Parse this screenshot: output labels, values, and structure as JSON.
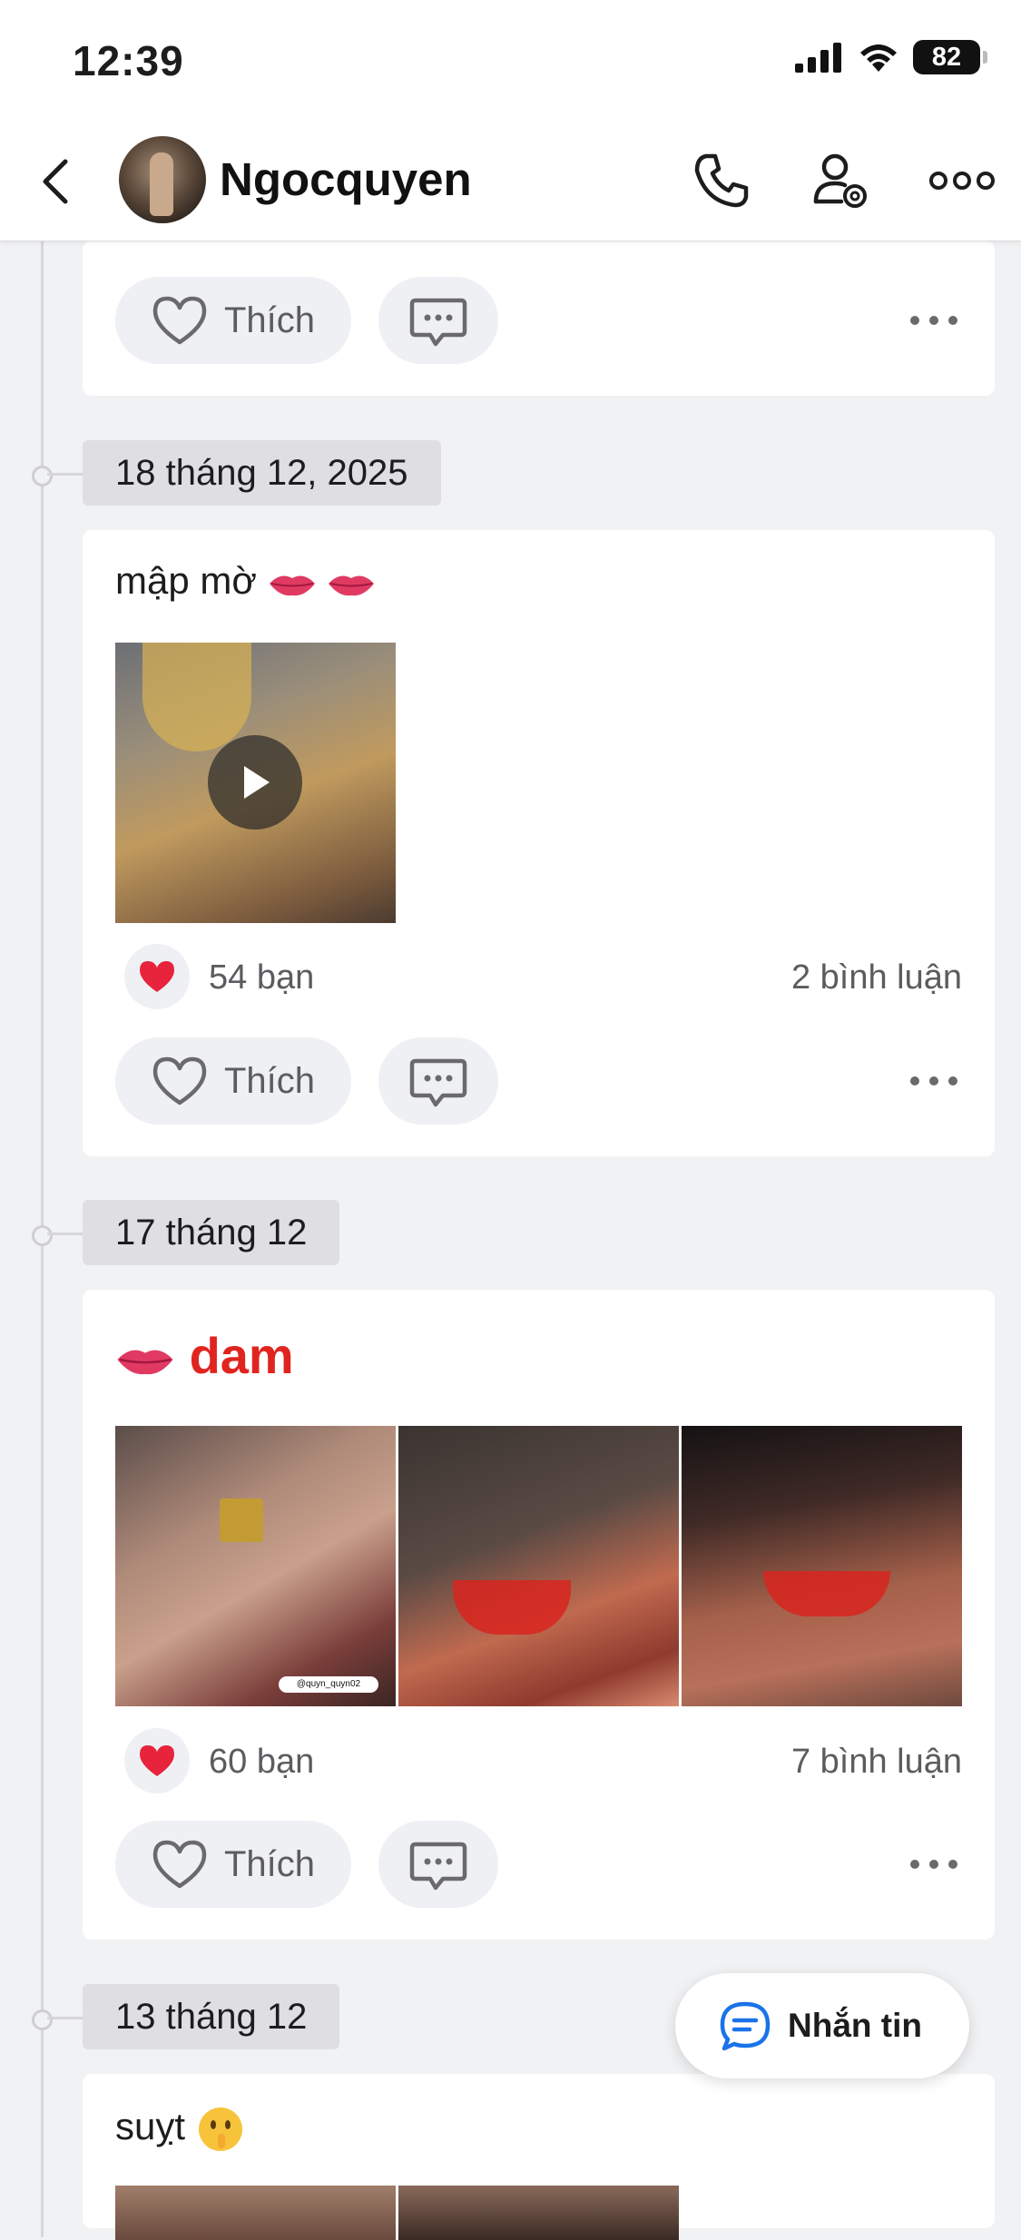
{
  "status_bar": {
    "time": "12:39",
    "battery": "82"
  },
  "header": {
    "name": "Ngocquyen"
  },
  "top_card": {
    "like_label": "Thích"
  },
  "posts": [
    {
      "date": "18 tháng 12, 2025",
      "text": "mập mờ",
      "reaction_count": "54 bạn",
      "comment_count": "2 bình luận",
      "like_label": "Thích"
    },
    {
      "date": "17 tháng 12",
      "text": "dam",
      "reaction_count": "60 bạn",
      "comment_count": "7 bình luận",
      "like_label": "Thích",
      "image_caption": "@quyn_quyn02"
    },
    {
      "date": "13 tháng 12",
      "text": "suỵt"
    }
  ],
  "fab": {
    "label": "Nhắn tin"
  },
  "colors": {
    "accent": "#1a73e8",
    "heart": "#e8243c",
    "title_red": "#e0241f"
  },
  "icons": [
    "back-icon",
    "phone-icon",
    "user-settings-icon",
    "more-icon",
    "heart-icon",
    "comment-icon",
    "play-icon",
    "chat-icon"
  ]
}
